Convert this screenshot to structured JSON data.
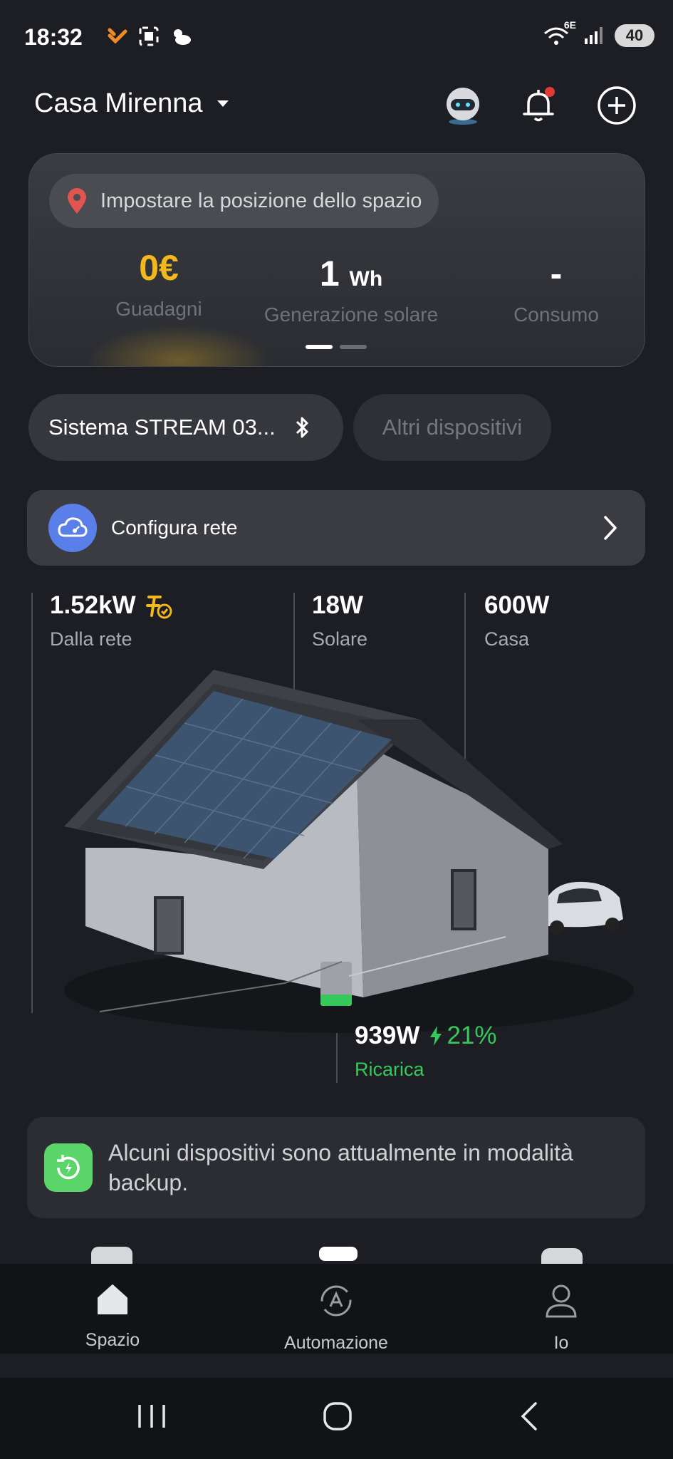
{
  "status_bar": {
    "time": "18:32",
    "network": "6E",
    "battery": "40"
  },
  "header": {
    "space_name": "Casa Mirenna"
  },
  "summary": {
    "location_prompt": "Impostare la posizione dello spazio",
    "earnings": {
      "value": "0€",
      "label": "Guadagni"
    },
    "solar": {
      "value": "1",
      "unit": "Wh",
      "label": "Generazione solare"
    },
    "consumption": {
      "value": "-",
      "label": "Consumo"
    }
  },
  "devices": {
    "system_chip": "Sistema STREAM 03...",
    "other_chip": "Altri dispositivi"
  },
  "network_setup": {
    "label": "Configura rete"
  },
  "energy_flow": {
    "grid": {
      "value": "1.52kW",
      "label": "Dalla rete"
    },
    "solar": {
      "value": "18W",
      "label": "Solare"
    },
    "home": {
      "value": "600W",
      "label": "Casa"
    },
    "battery": {
      "value": "939W",
      "percent": "21%",
      "label": "Ricarica"
    }
  },
  "backup_notice": {
    "text": "Alcuni dispositivi sono attualmente in modalità backup."
  },
  "bottom_nav": {
    "items": [
      {
        "label": "Spazio"
      },
      {
        "label": "Automazione"
      },
      {
        "label": "Io"
      }
    ]
  },
  "colors": {
    "accent_gold": "#f2b81e",
    "charge_green": "#35c85a",
    "link_blue": "#5a7fe8"
  }
}
